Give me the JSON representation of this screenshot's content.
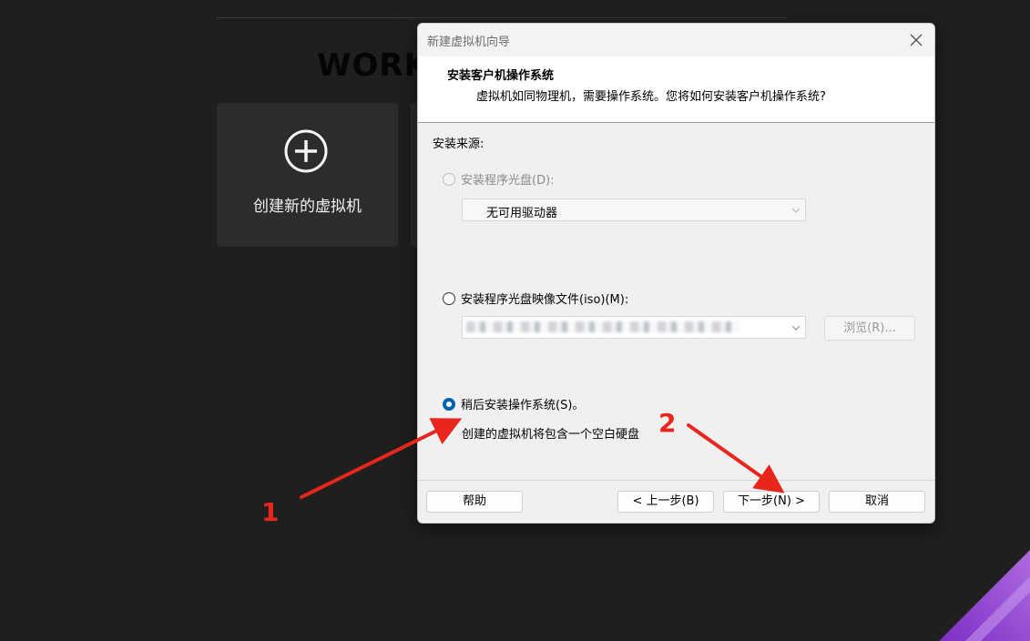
{
  "background": {
    "title": "WORK",
    "create_tile_label": "创建新的虚拟机",
    "colors": {
      "page": "#1f1f20",
      "tile": "#2c2c2e",
      "accent_purple": "#8a3fd0"
    }
  },
  "dialog": {
    "window_title": "新建虚拟机向导",
    "header_title": "安装客户机操作系统",
    "header_subtitle": "虚拟机如同物理机，需要操作系统。您将如何安装客户机操作系统?",
    "source_label": "安装来源:",
    "options": {
      "disc": {
        "label": "安装程序光盘(D):",
        "enabled": false,
        "selected": false,
        "drive_value": "无可用驱动器"
      },
      "iso": {
        "label": "安装程序光盘映像文件(iso)(M):",
        "enabled": true,
        "selected": false,
        "browse_label": "浏览(R)..."
      },
      "later": {
        "label": "稍后安装操作系统(S)。",
        "enabled": true,
        "selected": true,
        "note": "创建的虚拟机将包含一个空白硬盘"
      }
    },
    "buttons": {
      "help": "帮助",
      "back": "< 上一步(B)",
      "next": "下一步(N) >",
      "cancel": "取消"
    },
    "colors": {
      "radio_selected": "#0063b1"
    }
  },
  "annotations": {
    "label_1": "1",
    "label_2": "2",
    "color": "#e8261b"
  }
}
